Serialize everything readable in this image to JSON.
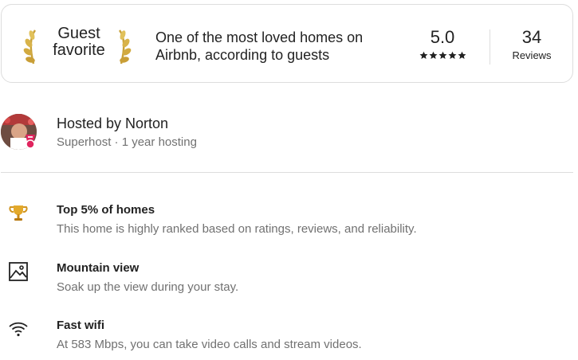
{
  "guest_favorite": {
    "title": "Guest favorite",
    "description": "One of the most loved homes on Airbnb, according to guests",
    "rating": "5.0",
    "stars": 5,
    "reviews_count": "34",
    "reviews_label": "Reviews"
  },
  "host": {
    "name": "Hosted by Norton",
    "subtitle": "Superhost · 1 year hosting",
    "badge_color": "#e0245e"
  },
  "features": [
    {
      "icon": "trophy-icon",
      "title": "Top 5% of homes",
      "description": "This home is highly ranked based on ratings, reviews, and reliability."
    },
    {
      "icon": "mountain-view-icon",
      "title": "Mountain view",
      "description": "Soak up the view during your stay."
    },
    {
      "icon": "wifi-icon",
      "title": "Fast wifi",
      "description": "At 583 Mbps, you can take video calls and stream videos."
    }
  ]
}
